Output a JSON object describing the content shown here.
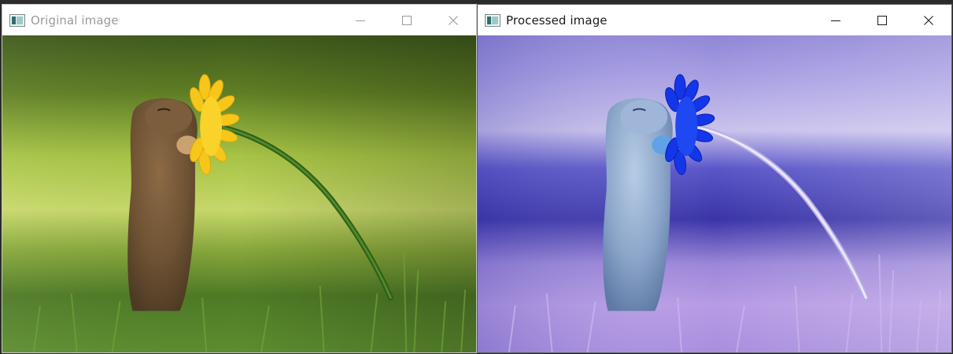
{
  "windows": [
    {
      "title": "Original image",
      "active": false,
      "icons": [
        "app-icon",
        "minimize-icon",
        "maximize-icon",
        "close-icon"
      ]
    },
    {
      "title": "Processed image",
      "active": true,
      "icons": [
        "app-icon",
        "minimize-icon",
        "maximize-icon",
        "close-icon"
      ]
    }
  ],
  "colors": {
    "original_background": "#8fb23a",
    "original_flower": "#f5c514",
    "original_stem": "#3a6a1c",
    "processed_background": "#8f7fdc",
    "processed_flower": "#1238e0",
    "processed_stem": "#d8d0f0",
    "title_inactive": "#9a9a9a",
    "title_active": "#1a1a1a"
  }
}
